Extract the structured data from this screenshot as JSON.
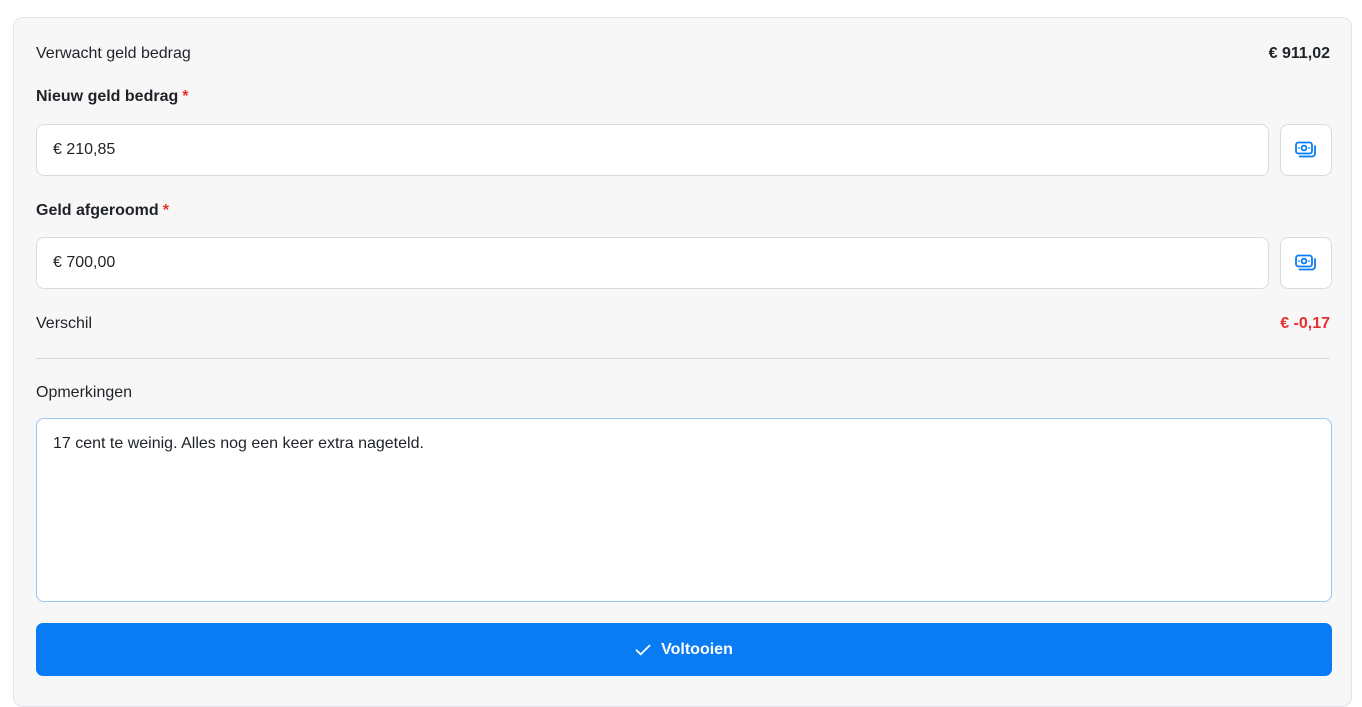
{
  "expected": {
    "label": "Verwacht geld bedrag",
    "value": "€ 911,02"
  },
  "new_amount": {
    "label": "Nieuw geld bedrag",
    "required_mark": "*",
    "value": "€ 210,85",
    "icon": "cash-icon"
  },
  "skimmed": {
    "label": "Geld afgeroomd",
    "required_mark": "*",
    "value": "€ 700,00",
    "icon": "cash-icon"
  },
  "difference": {
    "label": "Verschil",
    "value": "€ -0,17",
    "color": "#e5302d"
  },
  "notes": {
    "label": "Opmerkingen",
    "value": "17 cent te weinig. Alles nog een keer extra nageteld."
  },
  "submit": {
    "label": "Voltooien",
    "icon": "check-icon",
    "color": "#0a7cf3"
  }
}
